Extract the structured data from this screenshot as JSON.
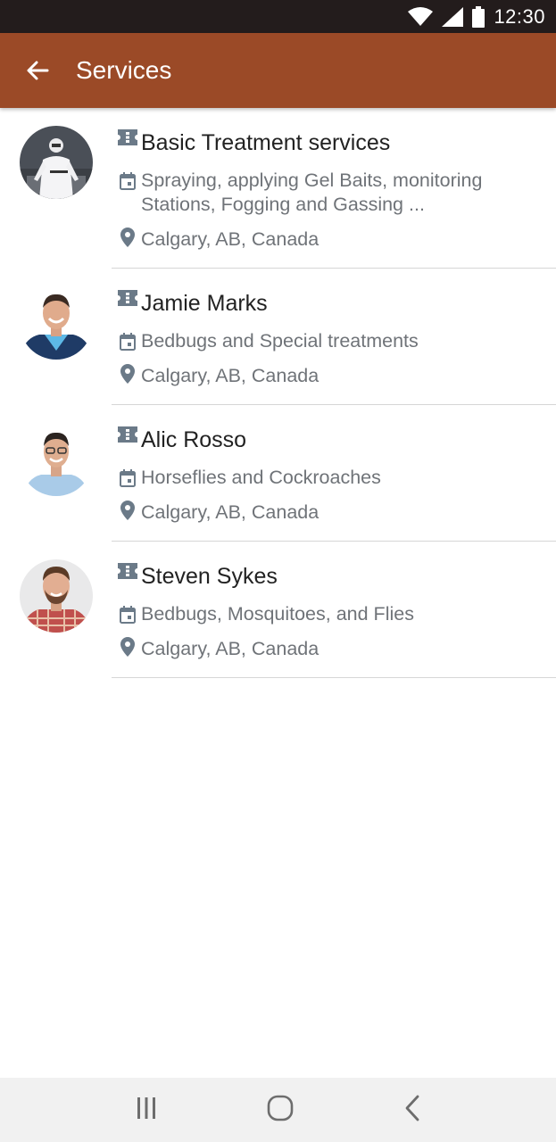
{
  "status_bar": {
    "time": "12:30"
  },
  "app_bar": {
    "title": "Services"
  },
  "services": [
    {
      "title": "Basic Treatment services",
      "description": "Spraying, applying Gel Baits, monitoring Stations, Fogging and Gassing ...",
      "location": "Calgary, AB, Canada"
    },
    {
      "title": "Jamie Marks",
      "description": "Bedbugs and Special treatments",
      "location": "Calgary, AB, Canada"
    },
    {
      "title": "Alic Rosso",
      "description": "Horseflies and Cockroaches",
      "location": "Calgary, AB, Canada"
    },
    {
      "title": "Steven Sykes",
      "description": "Bedbugs, Mosquitoes, and Flies",
      "location": "Calgary, AB, Canada"
    }
  ],
  "icons": {
    "ticket": "ticket-icon",
    "calendar": "calendar-icon",
    "location": "location-pin-icon"
  },
  "colors": {
    "app_bar": "#9b4a27",
    "status_bar": "#231c1c",
    "icon_gray": "#6b7a88"
  }
}
